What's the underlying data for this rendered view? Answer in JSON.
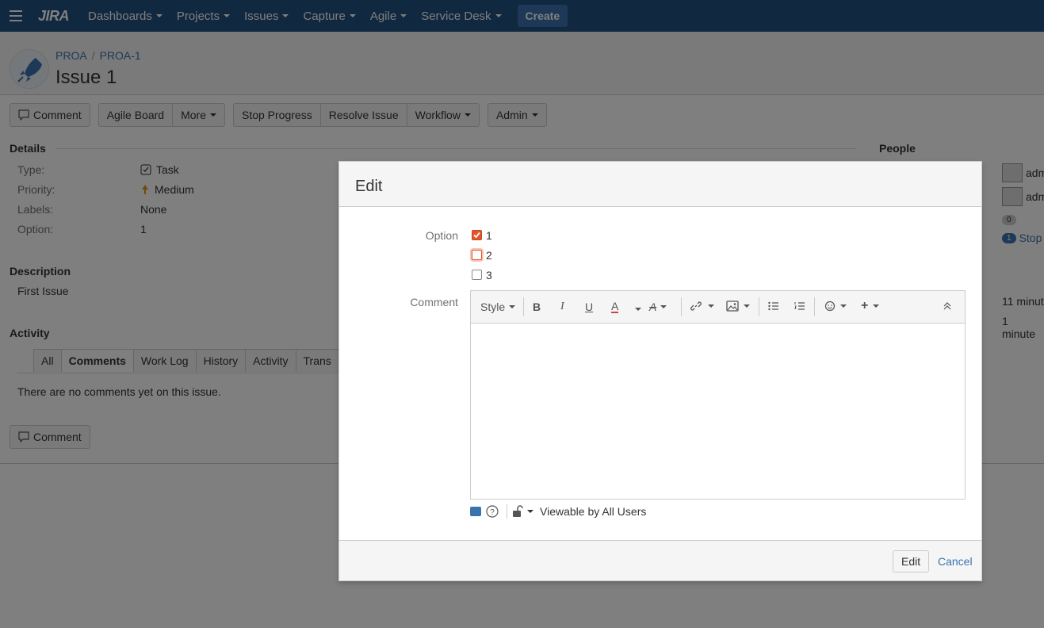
{
  "topbar": {
    "logo": "JIRA",
    "nav": [
      "Dashboards",
      "Projects",
      "Issues",
      "Capture",
      "Agile",
      "Service Desk"
    ],
    "create_label": "Create"
  },
  "header": {
    "project": "PROA",
    "issue_key": "PROA-1",
    "title": "Issue 1"
  },
  "toolbar": {
    "comment": "Comment",
    "agile_board": "Agile Board",
    "more": "More",
    "stop_progress": "Stop Progress",
    "resolve_issue": "Resolve Issue",
    "workflow": "Workflow",
    "admin": "Admin"
  },
  "details": {
    "title": "Details",
    "type_label": "Type:",
    "type_value": "Task",
    "priority_label": "Priority:",
    "priority_value": "Medium",
    "labels_label": "Labels:",
    "labels_value": "None",
    "option_label": "Option:",
    "option_value": "1"
  },
  "people": {
    "title": "People",
    "assignee": "adm",
    "reporter": "adm",
    "votes": "0",
    "watchers": "1",
    "watch_text": "Stop"
  },
  "dates": {
    "created": "11 minut",
    "updated": "1 minute"
  },
  "description": {
    "title": "Description",
    "text": "First Issue"
  },
  "activity": {
    "title": "Activity",
    "tabs": [
      "All",
      "Comments",
      "Work Log",
      "History",
      "Activity",
      "Trans"
    ],
    "empty_text": "There are no comments yet on this issue.",
    "comment_button": "Comment"
  },
  "dialog": {
    "title": "Edit",
    "option_label": "Option",
    "options": [
      {
        "label": "1",
        "checked": true
      },
      {
        "label": "2",
        "checked": false
      },
      {
        "label": "3",
        "checked": false
      }
    ],
    "comment_label": "Comment",
    "style_label": "Style",
    "visibility": "Viewable by All Users",
    "submit": "Edit",
    "cancel": "Cancel"
  },
  "colors": {
    "topbar": "#205081",
    "link": "#3b73af",
    "checkbox_accent": "#e4562a"
  }
}
